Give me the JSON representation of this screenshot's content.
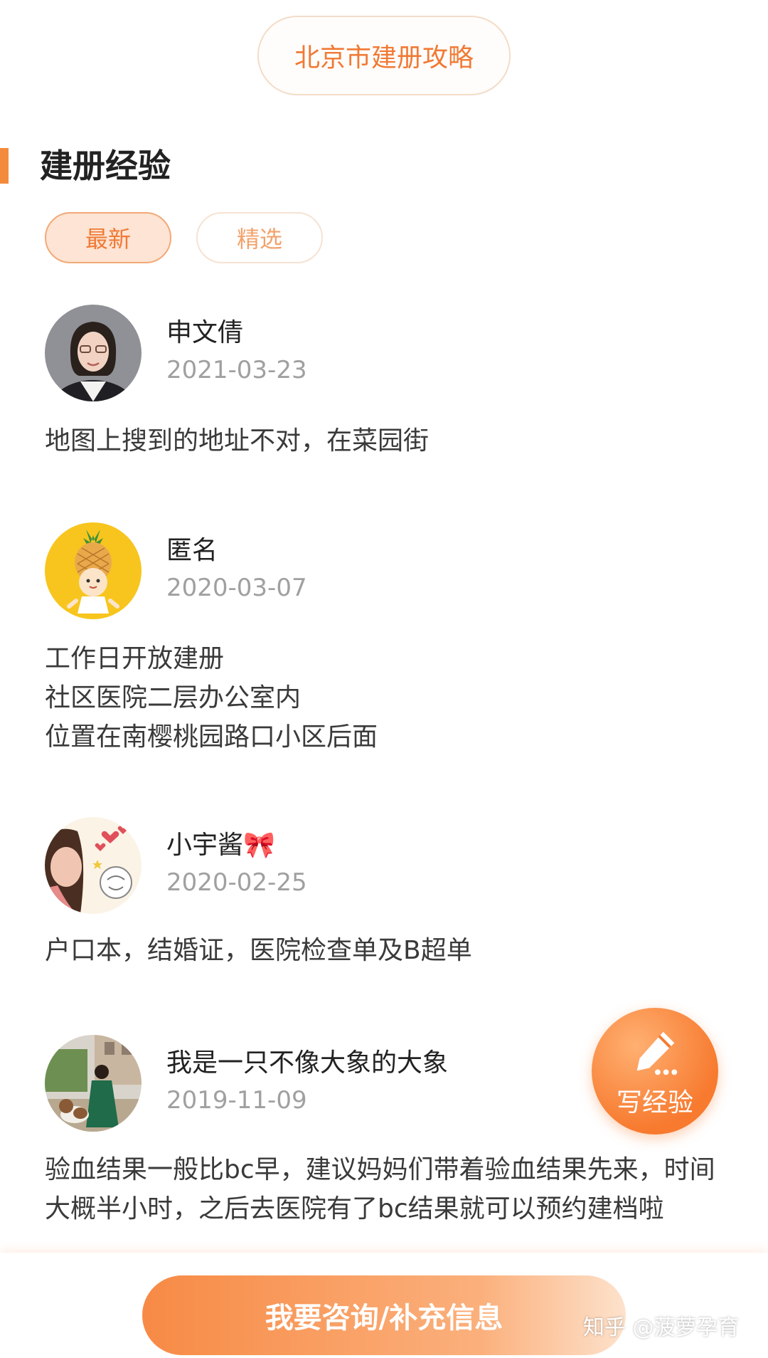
{
  "header": {
    "guide_button": "北京市建册攻略"
  },
  "section": {
    "title": "建册经验"
  },
  "tabs": [
    {
      "label": "最新",
      "active": true
    },
    {
      "label": "精选",
      "active": false
    }
  ],
  "posts": [
    {
      "author": "申文倩",
      "date": "2021-03-23",
      "avatar": "woman-portrait-avatar",
      "lines": [
        "地图上搜到的地址不对，在菜园街"
      ]
    },
    {
      "author": "匿名",
      "date": "2020-03-07",
      "avatar": "pineapple-cartoon-avatar",
      "lines": [
        "工作日开放建册",
        "社区医院二层办公室内",
        "位置在南樱桃园路口小区后面"
      ]
    },
    {
      "author": "小宇酱🎀",
      "date": "2020-02-25",
      "avatar": "girl-hearts-avatar",
      "lines": [
        "户口本，结婚证，医院检查单及B超单"
      ]
    },
    {
      "author": "我是一只不像大象的大象",
      "date": "2019-11-09",
      "avatar": "woman-with-dog-avatar",
      "lines": [
        "验血结果一般比bc早，建议妈妈们带着验血结果先来，时间",
        "大概半小时，之后去医院有了bc结果就可以预约建档啦"
      ]
    }
  ],
  "fab": {
    "label": "写经验",
    "icon": "pencil-icon"
  },
  "bottom": {
    "consult_button": "我要咨询/补充信息"
  },
  "watermark": "知乎 @菠萝孕育",
  "colors": {
    "accent": "#f07a35",
    "tab_active_bg": "#fde4d4"
  }
}
